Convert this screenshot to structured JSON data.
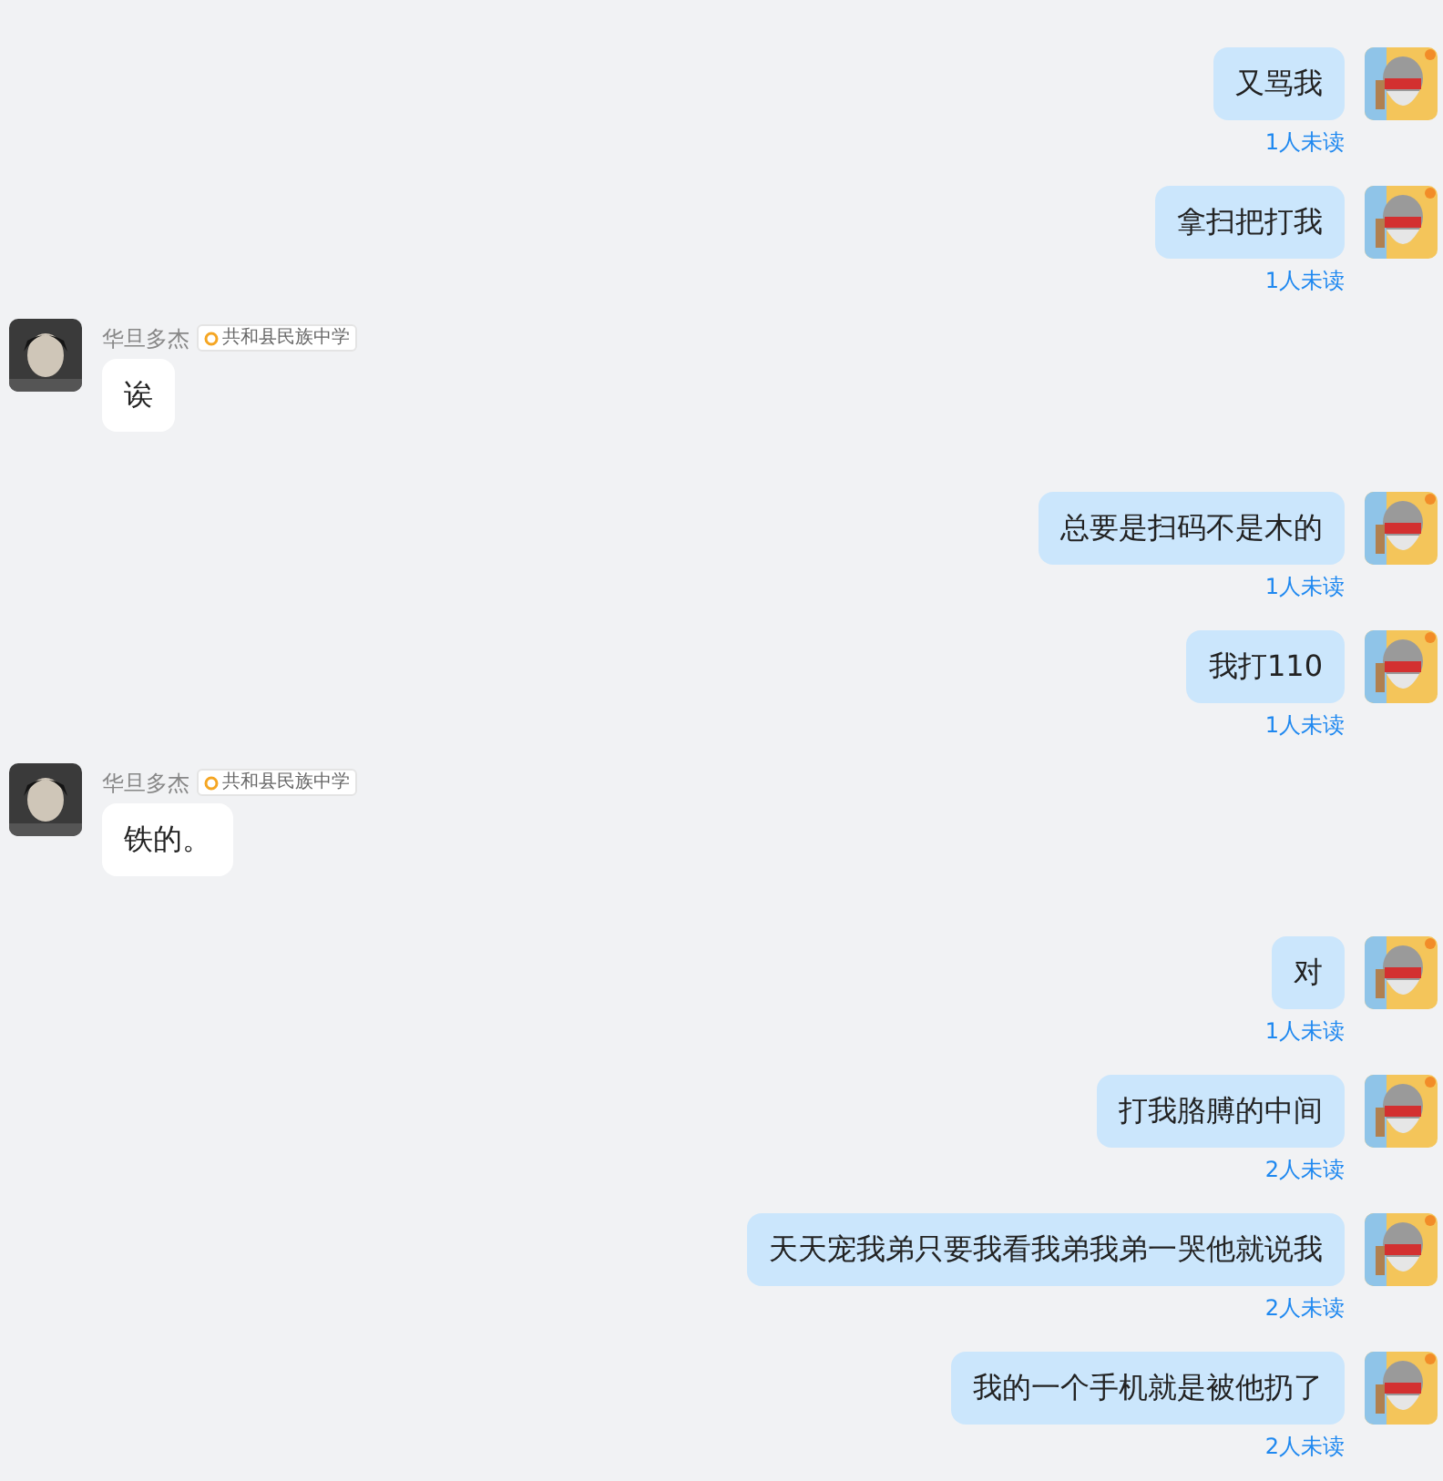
{
  "messages": [
    {
      "kind": "sent",
      "text": "又骂我",
      "receipt": "1人未读"
    },
    {
      "kind": "sent",
      "text": "拿扫把打我",
      "receipt": "1人未读"
    },
    {
      "kind": "received",
      "sender": "华旦多杰",
      "badge": "共和县民族中学",
      "text": "诶"
    },
    {
      "kind": "sent",
      "text": "总要是扫码不是木的",
      "receipt": "1人未读"
    },
    {
      "kind": "sent",
      "text": "我打110",
      "receipt": "1人未读"
    },
    {
      "kind": "received",
      "sender": "华旦多杰",
      "badge": "共和县民族中学",
      "text": "铁的。"
    },
    {
      "kind": "sent",
      "text": "对",
      "receipt": "1人未读"
    },
    {
      "kind": "sent",
      "text": "打我胳膊的中间",
      "receipt": "2人未读"
    },
    {
      "kind": "sent",
      "text": "天天宠我弟只要我看我弟我弟一哭他就说我",
      "receipt": "2人未读"
    },
    {
      "kind": "sent",
      "text": "我的一个手机就是被他扔了",
      "receipt": "2人未读"
    }
  ]
}
